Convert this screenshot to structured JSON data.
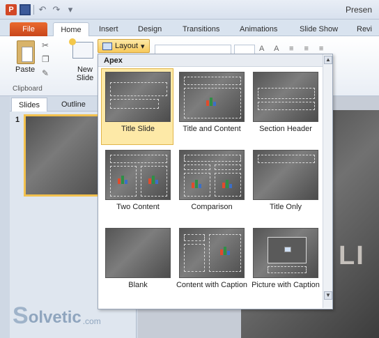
{
  "app": {
    "title": "Presen"
  },
  "qat": {
    "icons": [
      "powerpoint-icon",
      "save-icon",
      "undo-icon",
      "redo-icon",
      "customize-icon"
    ]
  },
  "tabs": [
    "File",
    "Home",
    "Insert",
    "Design",
    "Transitions",
    "Animations",
    "Slide Show",
    "Revi"
  ],
  "ribbon": {
    "paste_label": "Paste",
    "new_slide_label_1": "New",
    "new_slide_label_2": "Slide",
    "layout_label": "Layout",
    "clipboard_group": "Clipboard"
  },
  "left_pane": {
    "tab_slides": "Slides",
    "tab_outline": "Outline",
    "slide_number": "1"
  },
  "dropdown": {
    "theme": "Apex",
    "layouts": [
      "Title Slide",
      "Title and Content",
      "Section Header",
      "Two Content",
      "Comparison",
      "Title Only",
      "Blank",
      "Content with Caption",
      "Picture with Caption"
    ],
    "selected_index": 0
  },
  "slide_text": "LI",
  "watermark": {
    "text": "olvetic",
    "suffix": ".com"
  },
  "colors": {
    "file_tab": "#d24726",
    "selected": "#fde9a7",
    "accent_chart": [
      "#e04b2c",
      "#2f8f46",
      "#3c6fc7",
      "#f0b32e"
    ]
  }
}
